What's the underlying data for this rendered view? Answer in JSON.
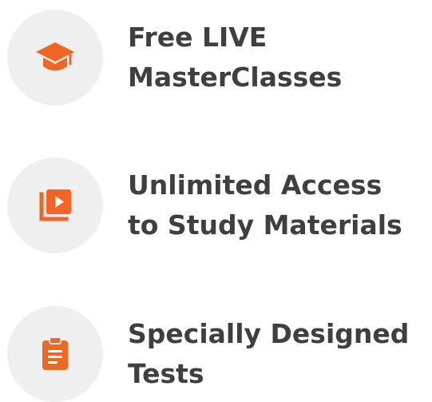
{
  "colors": {
    "accent": "#f26522",
    "icon_background": "#efefef",
    "text": "#3f3f3f"
  },
  "features": [
    {
      "icon": "graduation-cap-icon",
      "line1": "Free LIVE",
      "line2": "MasterClasses"
    },
    {
      "icon": "video-library-icon",
      "line1": "Unlimited Access",
      "line2": "to Study Materials"
    },
    {
      "icon": "clipboard-icon",
      "line1": "Specially Designed",
      "line2": "Tests"
    }
  ]
}
